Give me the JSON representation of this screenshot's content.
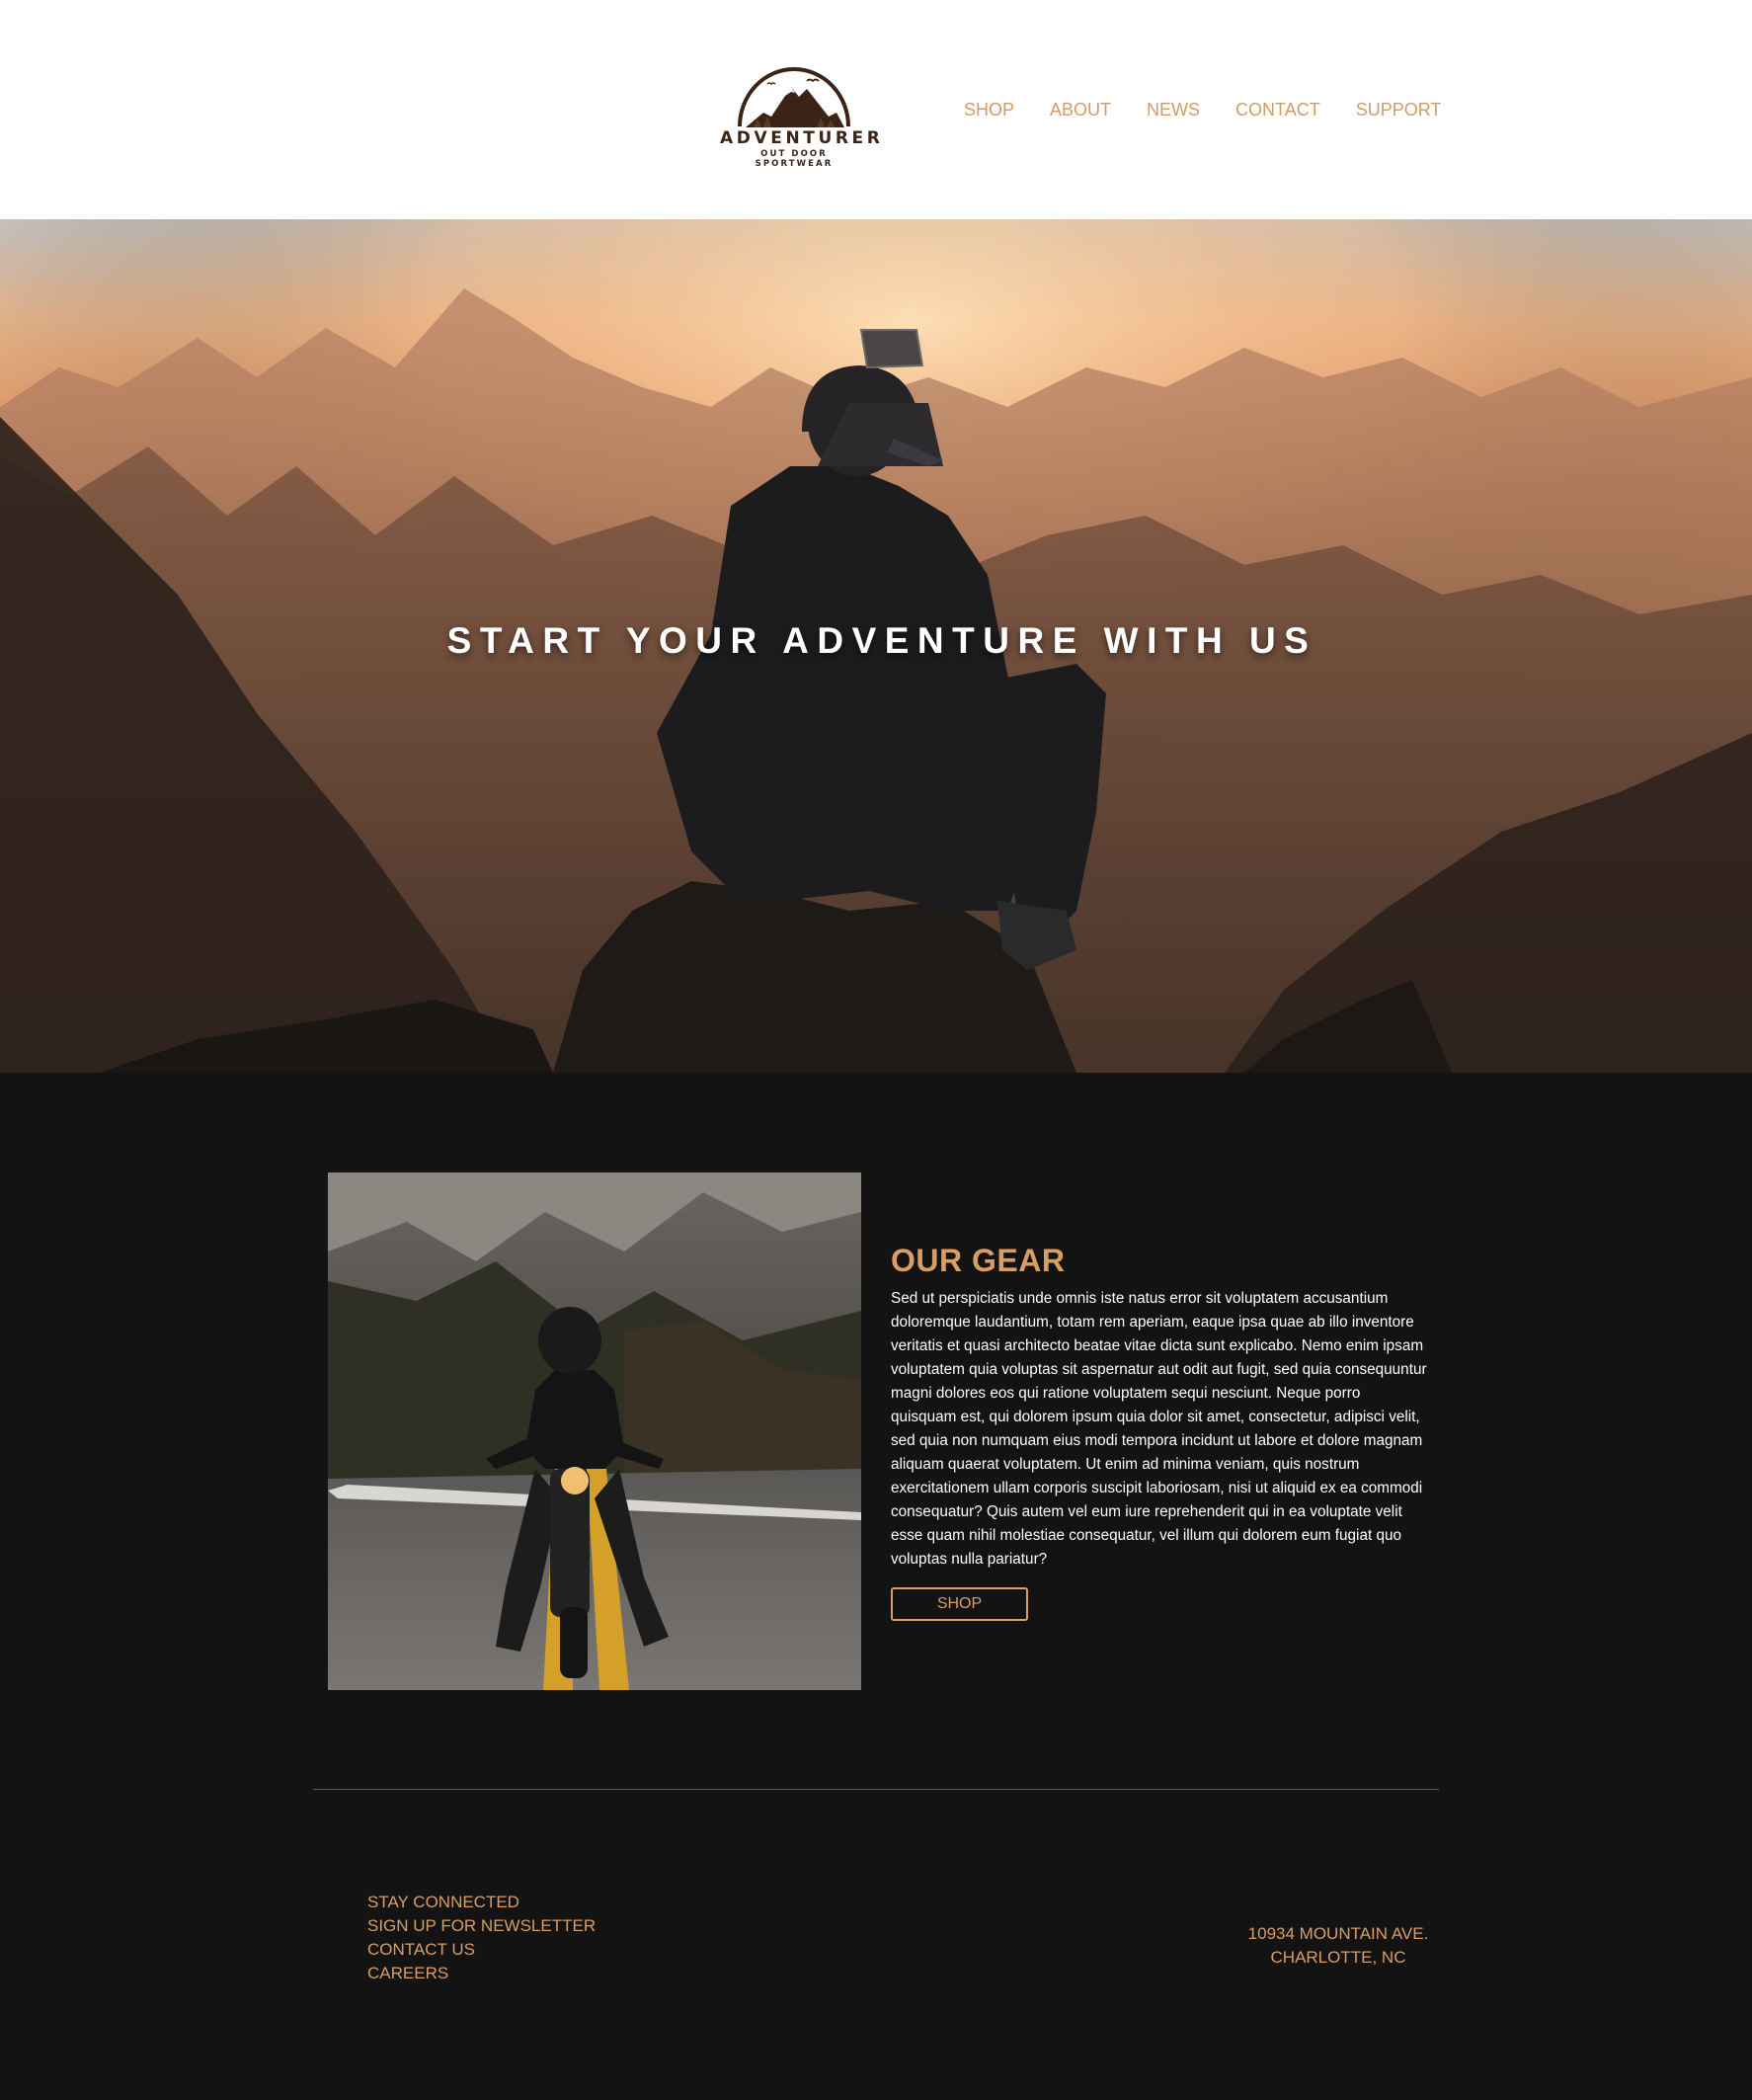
{
  "header": {
    "brand": "ADVENTURER",
    "tagline": "OUT DOOR SPORTWEAR",
    "nav": [
      "SHOP",
      "ABOUT",
      "NEWS",
      "CONTACT",
      "SUPPORT"
    ]
  },
  "hero": {
    "title": "START YOUR ADVENTURE WITH US"
  },
  "gear": {
    "title": "OUR GEAR",
    "body": "Sed ut perspiciatis unde omnis iste natus error sit voluptatem accusantium doloremque laudantium, totam rem aperiam, eaque ipsa quae ab illo inventore veritatis et quasi architecto beatae vitae dicta sunt explicabo. Nemo enim ipsam voluptatem quia voluptas sit aspernatur aut odit aut fugit, sed quia consequuntur magni dolores eos qui ratione voluptatem sequi nesciunt. Neque porro quisquam est, qui dolorem ipsum quia dolor sit amet, consectetur, adipisci velit, sed quia non numquam eius modi tempora incidunt ut labore et dolore magnam aliquam quaerat voluptatem. Ut enim ad minima veniam, quis nostrum exercitationem ullam corporis suscipit laboriosam, nisi ut aliquid ex ea commodi consequatur? Quis autem vel eum iure reprehenderit qui in ea voluptate velit esse quam nihil molestiae consequatur, vel illum qui dolorem eum fugiat quo voluptas nulla pariatur?",
    "button": "SHOP"
  },
  "footer": {
    "links": [
      "STAY CONNECTED",
      "SIGN UP FOR NEWSLETTER",
      "CONTACT US",
      "CAREERS"
    ],
    "address_line1": "10934 MOUNTAIN AVE.",
    "address_line2": "CHARLOTTE, NC"
  },
  "colors": {
    "accent": "#d89e63",
    "nav": "#cf9c68",
    "background": "#131313",
    "header_bg": "#ffffff",
    "logo": "#3b2416"
  },
  "icons": {
    "logo": "mountain-arch-logo"
  }
}
